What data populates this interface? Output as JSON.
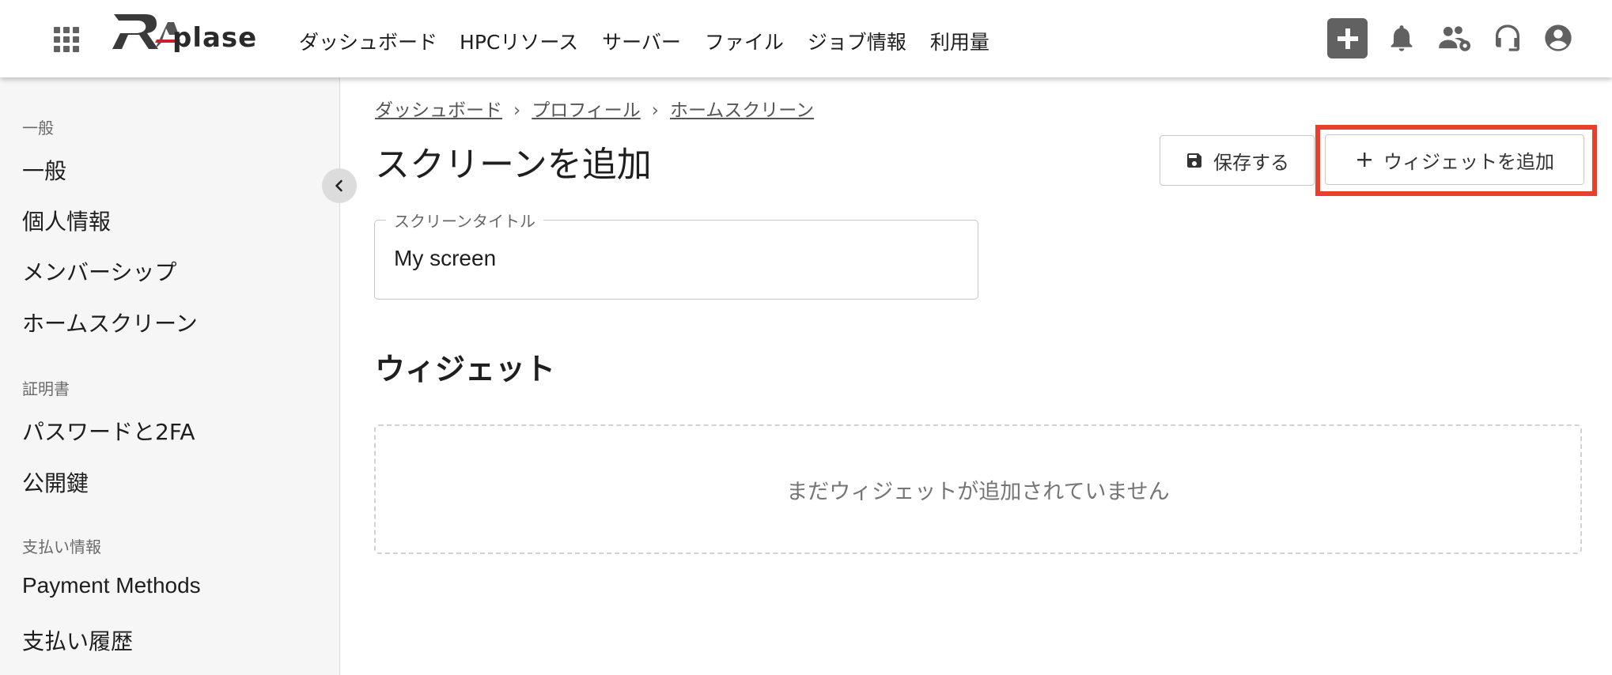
{
  "header": {
    "logo_text": "RA-plase",
    "nav": [
      "ダッシュボード",
      "HPCリソース",
      "サーバー",
      "ファイル",
      "ジョブ情報",
      "利用量"
    ],
    "icons": [
      "apps-grid-icon",
      "add-icon",
      "bell-icon",
      "group-settings-icon",
      "headset-icon",
      "account-icon"
    ]
  },
  "sidebar": {
    "sections": [
      {
        "title": "一般",
        "items": [
          "一般",
          "個人情報",
          "メンバーシップ",
          "ホームスクリーン"
        ]
      },
      {
        "title": "証明書",
        "items": [
          "パスワードと2FA",
          "公開鍵"
        ]
      },
      {
        "title": "支払い情報",
        "items": [
          "Payment Methods",
          "支払い履歴"
        ]
      }
    ]
  },
  "breadcrumb": [
    "ダッシュボード",
    "プロフィール",
    "ホームスクリーン"
  ],
  "page": {
    "title": "スクリーンを追加",
    "save_label": "保存する",
    "add_widget_label": "ウィジェットを追加"
  },
  "form": {
    "screen_title_label": "スクリーンタイトル",
    "screen_title_value": "My screen"
  },
  "widgets": {
    "section_title": "ウィジェット",
    "empty_message": "まだウィジェットが追加されていません"
  },
  "colors": {
    "highlight": "#e8402a",
    "plus_button": "#616161"
  }
}
